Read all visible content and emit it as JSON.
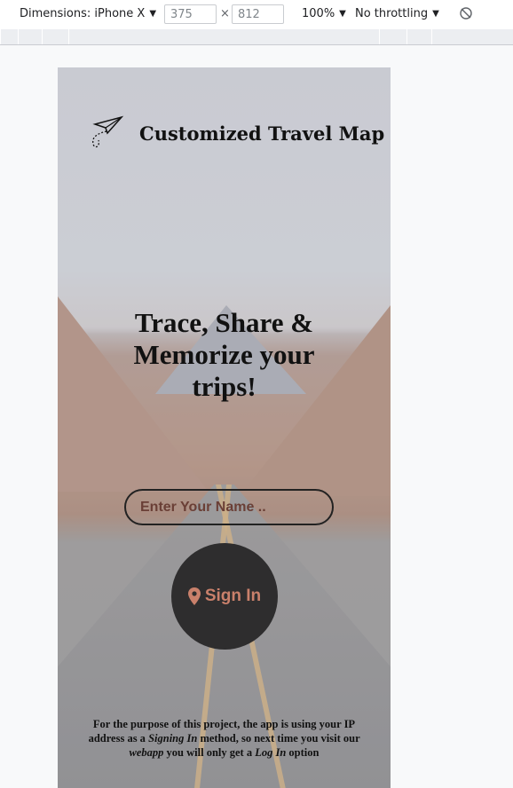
{
  "devtools": {
    "dimensions_label": "Dimensions: iPhone X",
    "width": "375",
    "height": "812",
    "times": "×",
    "zoom": "100%",
    "throttling": "No throttling",
    "rotate_icon": "rotate-icon"
  },
  "app": {
    "title": "Customized Travel Map",
    "logo_icon": "paper-plane-icon",
    "headline_line1": "Trace, Share &",
    "headline_line2": "Memorize your",
    "headline_line3": "trips!",
    "name_placeholder": "Enter Your Name ..",
    "signin_label": "Sign In",
    "signin_icon": "location-pin-icon",
    "note_part1": "For the purpose of this project, the app is using your IP address as a ",
    "note_em1": "Signing In",
    "note_part2": " method, so next time you visit our ",
    "note_em2": "webapp",
    "note_part3": " you will only get a ",
    "note_em3": "Log In",
    "note_part4": " option"
  },
  "colors": {
    "signin_bg": "#2e2d2e",
    "signin_text": "#c9806b"
  }
}
